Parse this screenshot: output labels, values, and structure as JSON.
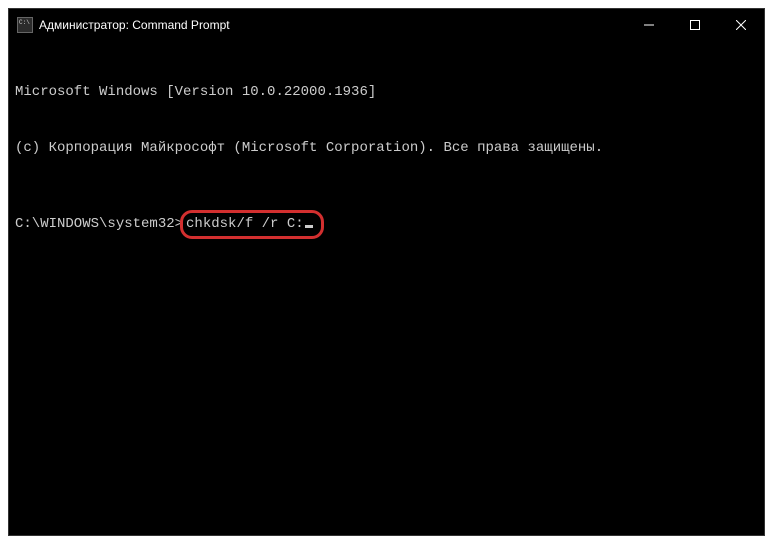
{
  "titlebar": {
    "title": "Администратор: Command Prompt"
  },
  "terminal": {
    "line1": "Microsoft Windows [Version 10.0.22000.1936]",
    "line2": "(c) Корпорация Майкрософт (Microsoft Corporation). Все права защищены.",
    "prompt": "C:\\WINDOWS\\system32>",
    "command": "chkdsk/f /r C:"
  }
}
